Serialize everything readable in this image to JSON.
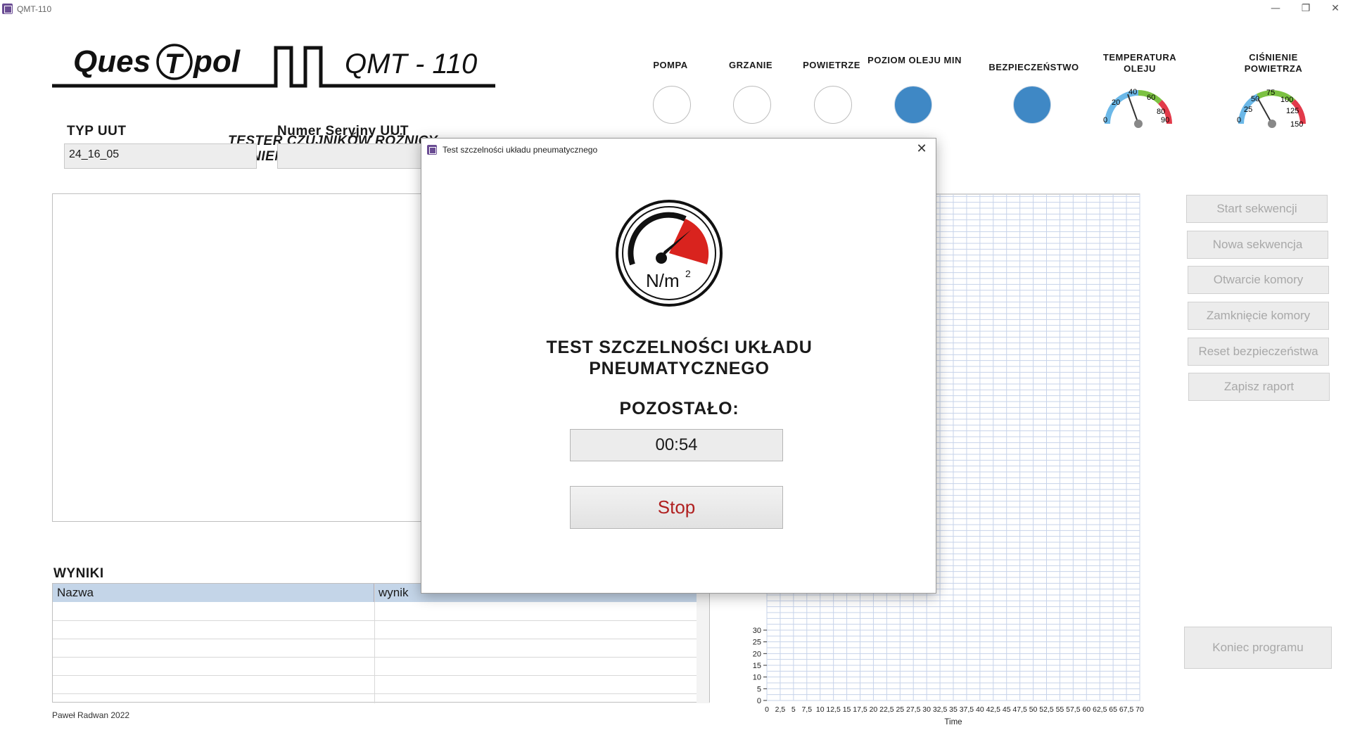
{
  "window": {
    "title": "QMT-110",
    "minimize": "—",
    "restore": "❐",
    "close": "✕"
  },
  "logo": {
    "brand_left": "Ques",
    "brand_mid": "T",
    "brand_right": "pol",
    "model": "QMT - 110",
    "subtitle": "TESTER CZUJNIKÓW RÓŻNICY CIŚNIEŃ IDG"
  },
  "indicators": [
    {
      "label": "POMPA",
      "state": "off"
    },
    {
      "label": "GRZANIE",
      "state": "off"
    },
    {
      "label": "POWIETRZE",
      "state": "off"
    },
    {
      "label": "POZIOM OLEJU MIN",
      "state": "on"
    },
    {
      "label": "BEZPIECZEŃSTWO",
      "state": "on"
    }
  ],
  "gauges": [
    {
      "label": "TEMPERATURA OLEJU",
      "ticks": [
        "0",
        "20",
        "40",
        "60",
        "80",
        "90"
      ],
      "value": 35
    },
    {
      "label": "CIŚNIENIE POWIETRZA",
      "ticks": [
        "0",
        "25",
        "50",
        "75",
        "100",
        "125",
        "150"
      ],
      "value": 55
    }
  ],
  "fields": {
    "typ_uut_label": "TYP UUT",
    "typ_uut_value": "24_16_05",
    "serial_label": "Numer Seryjny UUT",
    "serial_value": ""
  },
  "buttons": {
    "start": "Start sekwencji",
    "new": "Nowa sekwencja",
    "open": "Otwarcie komory",
    "close": "Zamknięcie komory",
    "reset": "Reset bezpieczeństwa",
    "save": "Zapisz raport",
    "exit": "Koniec programu"
  },
  "results": {
    "title": "WYNIKI",
    "columns": [
      "Nazwa",
      "wynik"
    ]
  },
  "footer": "Paweł Radwan 2022",
  "chart_data": {
    "type": "line",
    "xlabel": "Time",
    "ylabel": "",
    "x_ticks": [
      "0",
      "2,5",
      "5",
      "7,5",
      "10",
      "12,5",
      "15",
      "17,5",
      "20",
      "22,5",
      "25",
      "27,5",
      "30",
      "32,5",
      "35",
      "37,5",
      "40",
      "42,5",
      "45",
      "47,5",
      "50",
      "52,5",
      "55",
      "57,5",
      "60",
      "62,5",
      "65",
      "67,5",
      "70"
    ],
    "y_ticks_visible": [
      "0",
      "5",
      "10",
      "15",
      "20",
      "25",
      "30"
    ],
    "xlim": [
      0,
      70
    ],
    "ylim": [
      0,
      30
    ],
    "series": [],
    "grid": true
  },
  "dialog": {
    "title": "Test szczelności układu pneumatycznego",
    "close": "✕",
    "gauge_unit": "N/m",
    "gauge_unit_sup": "2",
    "heading_line1": "TEST SZCZELNOŚCI UKŁADU",
    "heading_line2": "PNEUMATYCZNEGO",
    "remaining_label": "POZOSTAŁO:",
    "timer": "00:54",
    "stop": "Stop"
  },
  "colors": {
    "lamp_on": "#3f88c5",
    "stop_text": "#b02020",
    "grid": "#c7d3ea"
  }
}
